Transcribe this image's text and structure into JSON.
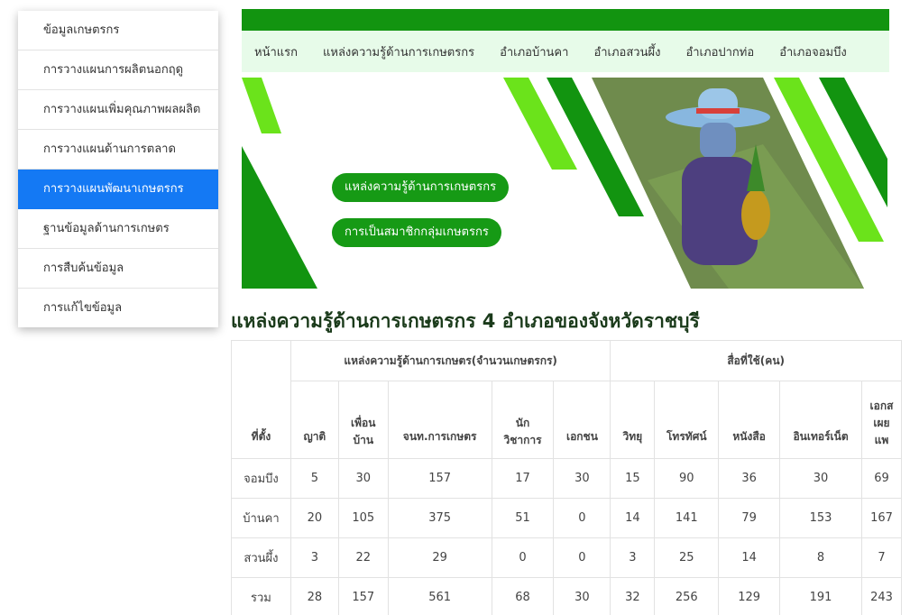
{
  "sidebar": {
    "items": [
      {
        "label": "ข้อมูลเกษตรกร"
      },
      {
        "label": "การวางแผนการผลิตนอกฤดู"
      },
      {
        "label": "การวางแผนเพิ่มคุณภาพผลผลิต"
      },
      {
        "label": "การวางแผนด้านการตลาด"
      },
      {
        "label": "การวางแผนพัฒนาเกษตรกร"
      },
      {
        "label": "ฐานข้อมูลด้านการเกษตร"
      },
      {
        "label": "การสืบค้นข้อมูล"
      },
      {
        "label": "การแก้ไขข้อมูล"
      }
    ],
    "active_index": 4
  },
  "nav": {
    "items": [
      {
        "label": "หน้าแรก"
      },
      {
        "label": "แหล่งความรู้ด้านการเกษตรกร"
      },
      {
        "label": "อำเภอบ้านคา"
      },
      {
        "label": "อำเภอสวนผึ้ง"
      },
      {
        "label": "อำเภอปากท่อ"
      },
      {
        "label": "อำเภอจอมบึง"
      }
    ]
  },
  "banner": {
    "button1": "แหล่งความรู้ด้านการเกษตรกร",
    "button2": "การเป็นสมาชิกกลุ่มเกษตรกร"
  },
  "title": "แหล่งความรู้ด้านการเกษตรกร 4 อำเภอของจังหวัดราชบุรี",
  "table": {
    "location_header": "ที่ตั้ง",
    "group1_header": "แหล่งความรู้ด้านการเกษตร(จำนวนเกษตรกร)",
    "group2_header": "สื่อที่ใช้(คน)",
    "subheaders": {
      "relatives": "ญาติ",
      "neighbor_l1": "เพื่อน",
      "neighbor_l2": "บ้าน",
      "officer": "จนท.การเกษตร",
      "academic_l1": "นัก",
      "academic_l2": "วิชาการ",
      "private": "เอกชน",
      "radio": "วิทยุ",
      "tv": "โทรทัศน์",
      "book": "หนังสือ",
      "internet": "อินเทอร์เน็ต",
      "doc_l1": "เอกส",
      "doc_l2": "เผย",
      "doc_l3": "แพ"
    },
    "rows": [
      {
        "location": "จอมบึง",
        "relatives": "5",
        "neighbor": "30",
        "officer": "157",
        "academic": "17",
        "private": "30",
        "radio": "15",
        "tv": "90",
        "book": "36",
        "internet": "30",
        "doc": "69"
      },
      {
        "location": "บ้านคา",
        "relatives": "20",
        "neighbor": "105",
        "officer": "375",
        "academic": "51",
        "private": "0",
        "radio": "14",
        "tv": "141",
        "book": "79",
        "internet": "153",
        "doc": "167"
      },
      {
        "location": "สวนผึ้ง",
        "relatives": "3",
        "neighbor": "22",
        "officer": "29",
        "academic": "0",
        "private": "0",
        "radio": "3",
        "tv": "25",
        "book": "14",
        "internet": "8",
        "doc": "7"
      },
      {
        "location": "รวม",
        "relatives": "28",
        "neighbor": "157",
        "officer": "561",
        "academic": "68",
        "private": "30",
        "radio": "32",
        "tv": "256",
        "book": "129",
        "internet": "191",
        "doc": "243"
      }
    ]
  },
  "colors": {
    "green_dark": "#129410",
    "green_bright": "#6be31b",
    "nav_bg": "#e7fbe9",
    "active_blue": "#1479f4"
  }
}
